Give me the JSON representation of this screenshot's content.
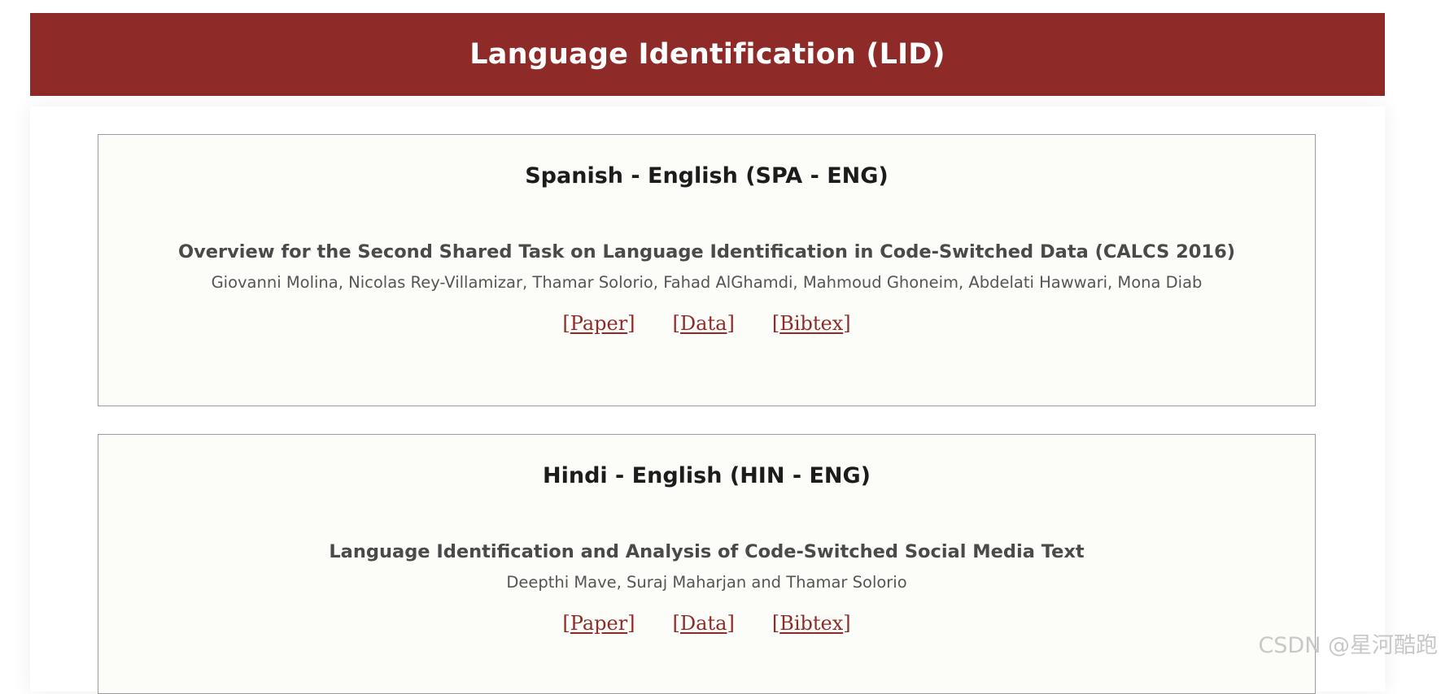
{
  "header": {
    "title": "Language Identification (LID)"
  },
  "cards": [
    {
      "lang_title": "Spanish - English (SPA - ENG)",
      "paper_title": "Overview for the Second Shared Task on Language Identification in Code-Switched Data (CALCS 2016)",
      "authors": "Giovanni Molina, Nicolas Rey-Villamizar, Thamar Solorio, Fahad AlGhamdi, Mahmoud Ghoneim, Abdelati Hawwari, Mona Diab",
      "links": {
        "paper": "Paper",
        "data": "Data",
        "bibtex": "Bibtex"
      }
    },
    {
      "lang_title": "Hindi - English (HIN - ENG)",
      "paper_title": "Language Identification and Analysis of Code-Switched Social Media Text",
      "authors": "Deepthi Mave, Suraj Maharjan and Thamar Solorio",
      "links": {
        "paper": "Paper",
        "data": "Data",
        "bibtex": "Bibtex"
      }
    }
  ],
  "watermark": "CSDN @星河酷跑",
  "colors": {
    "header_bg": "#8e2b28",
    "link": "#8e2b28",
    "card_bg": "#fcfdf9"
  }
}
